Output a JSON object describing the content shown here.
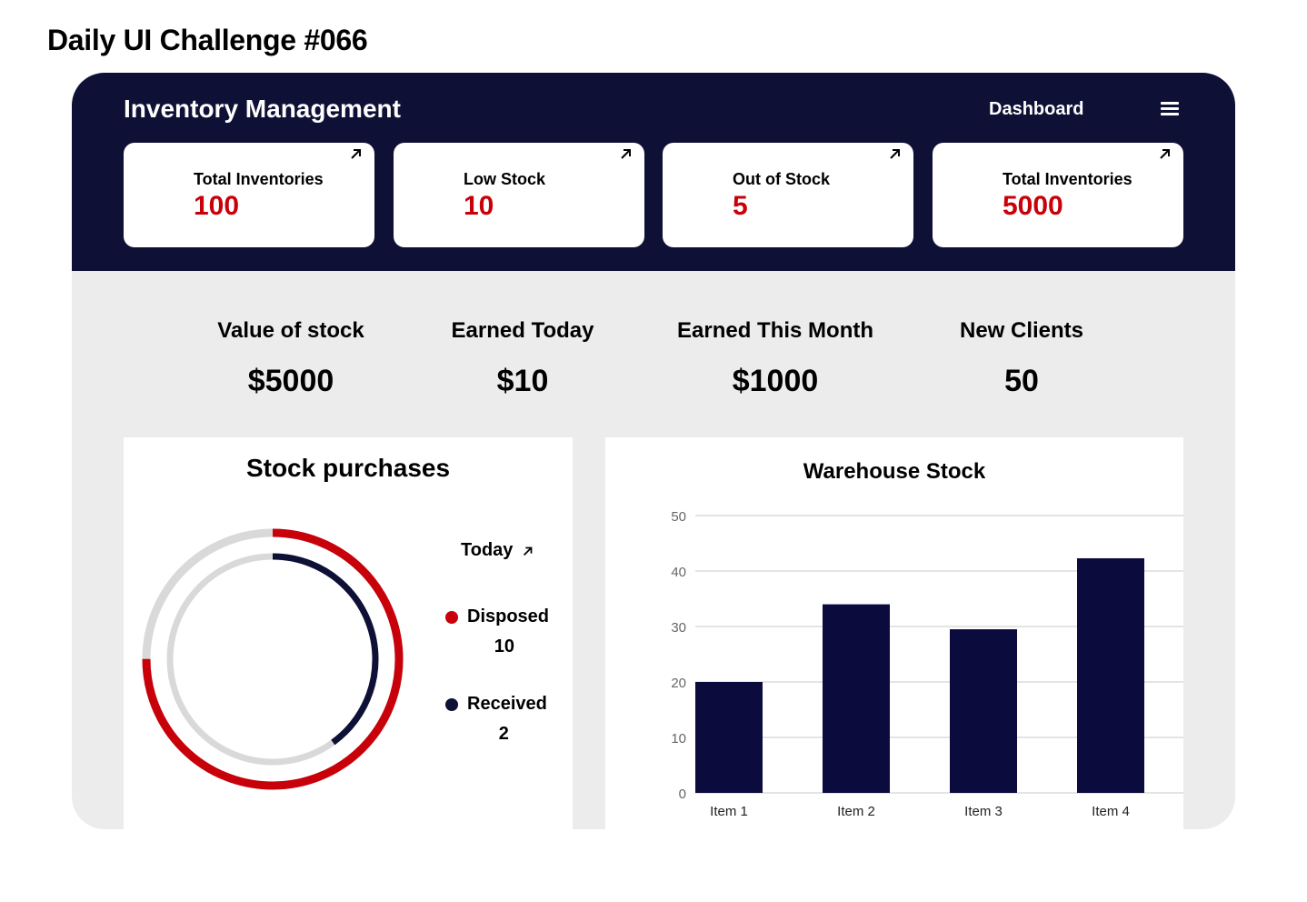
{
  "page": {
    "challenge_title": "Daily UI Challenge #066"
  },
  "header": {
    "app_title": "Inventory Management",
    "nav_label": "Dashboard",
    "menu_icon": "hamburger-menu-icon",
    "background": "#0e1035"
  },
  "kpis": [
    {
      "label": "Total Inventories",
      "value": "100",
      "icon": "arrow-up-right-icon"
    },
    {
      "label": "Low Stock",
      "value": "10",
      "icon": "arrow-up-right-icon"
    },
    {
      "label": "Out of Stock",
      "value": "5",
      "icon": "arrow-up-right-icon"
    },
    {
      "label": "Total Inventories",
      "value": "5000",
      "icon": "arrow-up-right-icon"
    }
  ],
  "stats": [
    {
      "label": "Value of stock",
      "value": "$5000"
    },
    {
      "label": "Earned Today",
      "value": "$10"
    },
    {
      "label": "Earned This Month",
      "value": "$1000"
    },
    {
      "label": "New Clients",
      "value": "50"
    }
  ],
  "stock_purchases": {
    "title": "Stock purchases",
    "period_label": "Today",
    "period_icon": "arrow-up-right-icon",
    "legend": [
      {
        "label": "Disposed",
        "value": "10",
        "color": "#c8000a"
      },
      {
        "label": "Received",
        "value": "2",
        "color": "#0e1035"
      }
    ]
  },
  "colors": {
    "accent_red": "#c8000a",
    "navy": "#0e1035",
    "track_gray": "#d9d9d9",
    "panel_bg": "#ececec"
  },
  "chart_data": [
    {
      "type": "pie",
      "title": "Stock purchases",
      "series": [
        {
          "name": "Disposed",
          "value": 10,
          "fraction_shown": 0.75
        },
        {
          "name": "Received",
          "value": 2,
          "fraction_shown": 0.4
        }
      ]
    },
    {
      "type": "bar",
      "title": "Warehouse Stock",
      "categories": [
        "Item 1",
        "Item 2",
        "Item 3",
        "Item 4"
      ],
      "values": [
        20,
        34,
        29.5,
        42.3
      ],
      "yticks": [
        "0",
        "10",
        "20",
        "30",
        "40",
        "50"
      ],
      "ylim": [
        0,
        50
      ],
      "grid": true
    }
  ]
}
